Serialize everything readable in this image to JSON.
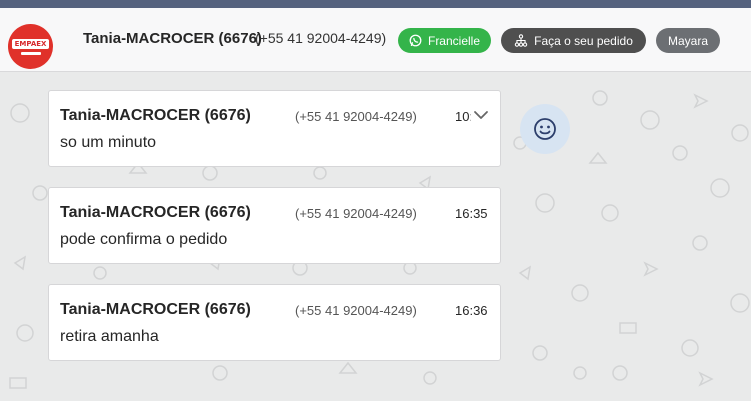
{
  "header": {
    "logo_text": "EMPAEX",
    "contact_name": "Tania-MACROCER (6676)",
    "contact_phone": "(+55 41 92004-4249)",
    "buttons": {
      "whatsapp_label": "Francielle",
      "order_label": "Faça o seu pedido",
      "agent_label": "Mayara"
    }
  },
  "messages": [
    {
      "sender": "Tania-MACROCER (6676)",
      "phone": "(+55 41 92004-4249)",
      "time": "10:",
      "text": "so um minuto"
    },
    {
      "sender": "Tania-MACROCER (6676)",
      "phone": "(+55 41 92004-4249)",
      "time": "16:35",
      "text": "pode confirma o pedido"
    },
    {
      "sender": "Tania-MACROCER (6676)",
      "phone": "(+55 41 92004-4249)",
      "time": "16:36",
      "text": "retira amanha"
    }
  ],
  "icons": {
    "react": "smiley-icon",
    "chevron": "chevron-down-icon",
    "whatsapp": "whatsapp-icon",
    "order": "sitemap-icon"
  },
  "colors": {
    "top_strip": "#55627e",
    "green_button": "#34b44a",
    "dark_button": "#4f4f4f",
    "gray_button": "#6c6f73",
    "logo_red": "#e0312a",
    "react_bg": "#d7e4f2"
  }
}
